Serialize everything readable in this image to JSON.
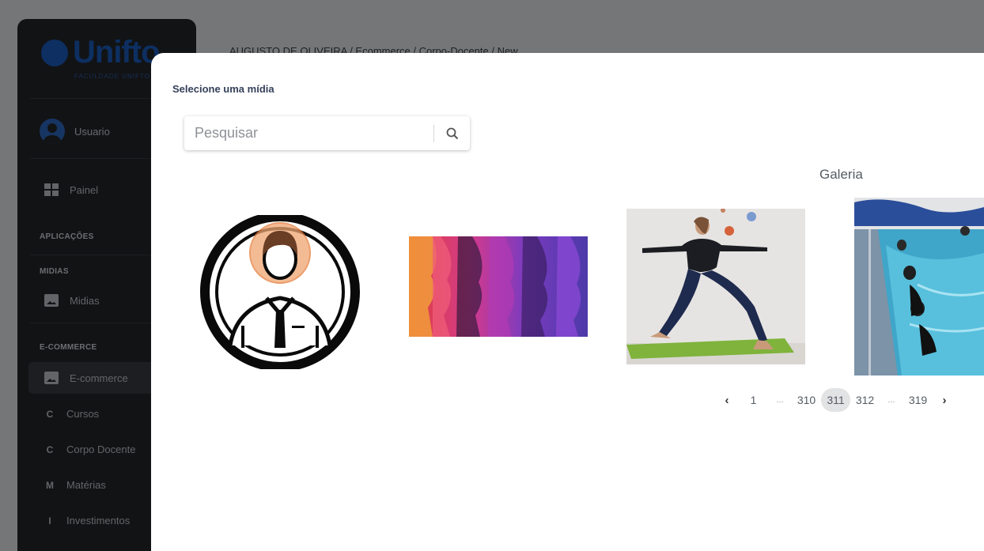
{
  "sidebar": {
    "brand_text": "Unifto",
    "brand_sub": "FACULDADE UNIFTO",
    "user_name": "Usuario",
    "items": [
      {
        "label": "Painel",
        "icon": "dashboard-icon"
      },
      {
        "section": "APLICAÇÕES"
      },
      {
        "section": "MIDIAS"
      },
      {
        "label": "Midias",
        "icon": "image-icon"
      },
      {
        "section": "E-COMMERCE"
      },
      {
        "label": "E-commerce",
        "icon": "image-icon"
      },
      {
        "label": "Cursos",
        "letter": "C"
      },
      {
        "label": "Corpo Docente",
        "letter": "C"
      },
      {
        "label": "Matérias",
        "letter": "M"
      },
      {
        "label": "Investimentos",
        "letter": "I"
      }
    ]
  },
  "breadcrumb": "AUGUSTO DE OLIVEIRA / Ecommerce / Corpo-Docente / New",
  "modal": {
    "title": "Selecione uma mídia",
    "search_placeholder": "Pesquisar",
    "gallery_title": "Galeria"
  },
  "pagination": {
    "prev": "‹",
    "pages": [
      "1",
      "...",
      "310",
      "311",
      "312",
      "...",
      "319"
    ],
    "current": "311",
    "next": "›"
  },
  "colors": {
    "sidebar_bg": "#24262a",
    "brand": "#1b5fc2",
    "modal_title": "#34405a",
    "pager_current_bg": "#e2e3e5"
  }
}
